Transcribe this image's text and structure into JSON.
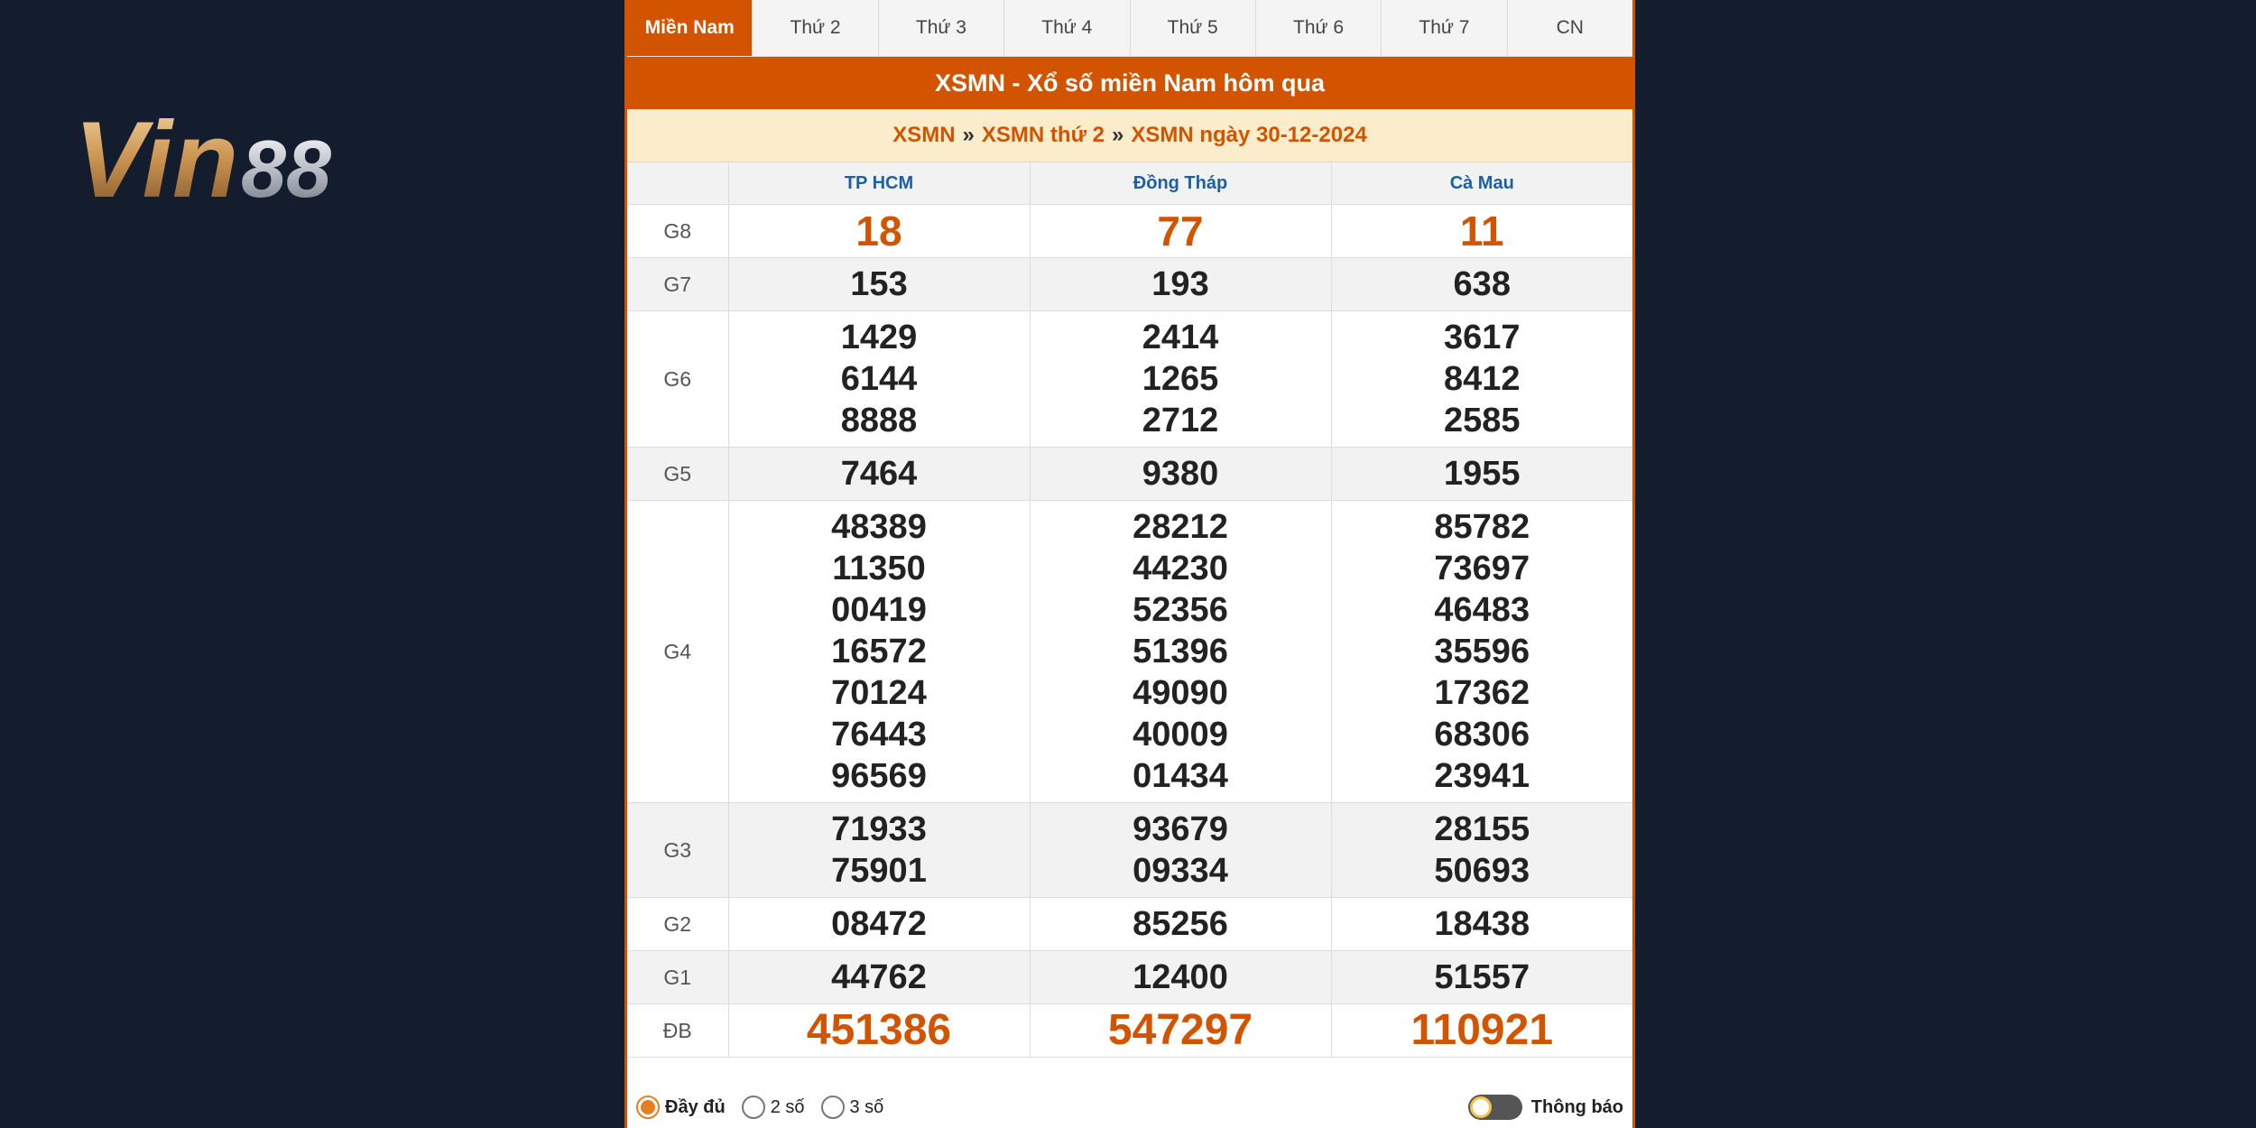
{
  "logo": {
    "text": "Vin88"
  },
  "tabs": [
    {
      "label": "Miền Nam",
      "active": true
    },
    {
      "label": "Thứ 2"
    },
    {
      "label": "Thứ 3"
    },
    {
      "label": "Thứ 4"
    },
    {
      "label": "Thứ 5"
    },
    {
      "label": "Thứ 6"
    },
    {
      "label": "Thứ 7"
    },
    {
      "label": "CN"
    }
  ],
  "title": "XSMN - Xổ số miền Nam hôm qua",
  "breadcrumb": {
    "items": [
      "XSMN",
      "XSMN thứ 2",
      "XSMN ngày 30-12-2024"
    ],
    "separator": "»"
  },
  "provinces": [
    "TP HCM",
    "Đồng Tháp",
    "Cà Mau"
  ],
  "prizes": [
    {
      "label": "G8",
      "cells": [
        [
          "18"
        ],
        [
          "77"
        ],
        [
          "11"
        ]
      ]
    },
    {
      "label": "G7",
      "cells": [
        [
          "153"
        ],
        [
          "193"
        ],
        [
          "638"
        ]
      ]
    },
    {
      "label": "G6",
      "cells": [
        [
          "1429",
          "6144",
          "8888"
        ],
        [
          "2414",
          "1265",
          "2712"
        ],
        [
          "3617",
          "8412",
          "2585"
        ]
      ]
    },
    {
      "label": "G5",
      "cells": [
        [
          "7464"
        ],
        [
          "9380"
        ],
        [
          "1955"
        ]
      ]
    },
    {
      "label": "G4",
      "cells": [
        [
          "48389",
          "11350",
          "00419",
          "16572",
          "70124",
          "76443",
          "96569"
        ],
        [
          "28212",
          "44230",
          "52356",
          "51396",
          "49090",
          "40009",
          "01434"
        ],
        [
          "85782",
          "73697",
          "46483",
          "35596",
          "17362",
          "68306",
          "23941"
        ]
      ]
    },
    {
      "label": "G3",
      "cells": [
        [
          "71933",
          "75901"
        ],
        [
          "93679",
          "09334"
        ],
        [
          "28155",
          "50693"
        ]
      ]
    },
    {
      "label": "G2",
      "cells": [
        [
          "08472"
        ],
        [
          "85256"
        ],
        [
          "18438"
        ]
      ]
    },
    {
      "label": "G1",
      "cells": [
        [
          "44762"
        ],
        [
          "12400"
        ],
        [
          "51557"
        ]
      ]
    },
    {
      "label": "ĐB",
      "cells": [
        [
          "451386"
        ],
        [
          "547297"
        ],
        [
          "110921"
        ]
      ]
    }
  ],
  "footer": {
    "options": [
      {
        "label": "Đầy đủ",
        "checked": true
      },
      {
        "label": "2 số"
      },
      {
        "label": "3 số"
      }
    ],
    "toggle_label": "Thông báo"
  },
  "colors": {
    "accent": "#d35400",
    "header_blue": "#1a5fa8",
    "breadcrumb_bg": "#fbeccb",
    "background": "#141d2d"
  }
}
